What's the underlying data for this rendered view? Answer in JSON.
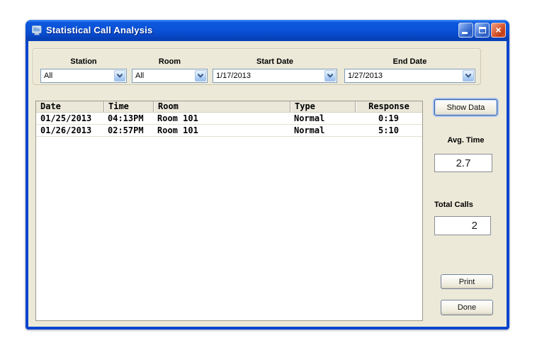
{
  "window": {
    "title": "Statistical Call Analysis",
    "close_glyph": "×"
  },
  "filters": {
    "station": {
      "label": "Station",
      "value": "All"
    },
    "room": {
      "label": "Room",
      "value": "All"
    },
    "start_date": {
      "label": "Start Date",
      "value": "1/17/2013"
    },
    "end_date": {
      "label": "End Date",
      "value": "1/27/2013"
    }
  },
  "table": {
    "columns": [
      "Date",
      "Time",
      "Room",
      "Type",
      "Response"
    ],
    "rows": [
      [
        "01/25/2013",
        "04:13PM",
        "Room 101",
        "Normal",
        "0:19"
      ],
      [
        "01/26/2013",
        "02:57PM",
        "Room 101",
        "Normal",
        "5:10"
      ]
    ]
  },
  "stats": {
    "avg_time": {
      "label": "Avg. Time",
      "value": "2.7"
    },
    "total_calls": {
      "label": "Total Calls",
      "value": "2"
    }
  },
  "actions": {
    "show_data": "Show Data",
    "print": "Print",
    "done": "Done"
  },
  "icons": {
    "app": "monitor-icon",
    "combo": "chevron-down-icon",
    "titlebar": [
      "minimize-icon",
      "maximize-icon",
      "close-icon"
    ]
  },
  "colors": {
    "titlebar_blue": "#0b53d8",
    "frame_blue": "#0845ce",
    "window_bg": "#ece9d8",
    "combo_border": "#7f9db9",
    "focus_ring": "#a4c2f1",
    "close_red": "#c33d16"
  }
}
